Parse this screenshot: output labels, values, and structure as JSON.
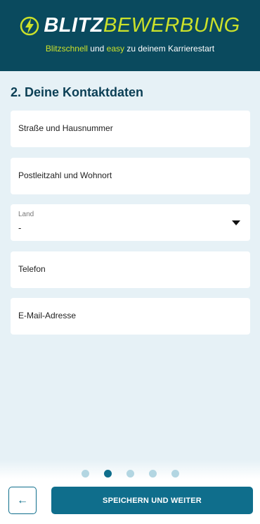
{
  "header": {
    "logo_bold": "BLITZ",
    "logo_thin": "BEWERBUNG",
    "tagline_part1": "Blitzschnell",
    "tagline_part2": " und ",
    "tagline_part3": "easy",
    "tagline_part4": " zu deinem Karrierestart",
    "bolt_icon": "lightning-bolt-icon",
    "brand_color": "#0a4a5e",
    "accent_color": "#cbe12a"
  },
  "form": {
    "section_title": "2. Deine Kontaktdaten",
    "street_placeholder": "Straße und Hausnummer",
    "zip_city_placeholder": "Postleitzahl und Wohnort",
    "country_label": "Land",
    "country_value": "-",
    "phone_placeholder": "Telefon",
    "email_placeholder": "E-Mail-Adresse"
  },
  "footer": {
    "steps_total": 5,
    "current_step": 2,
    "back_icon": "arrow-left-icon",
    "back_glyph": "←",
    "save_label": "SPEICHERN UND WEITER",
    "button_color": "#0f6e8c"
  }
}
